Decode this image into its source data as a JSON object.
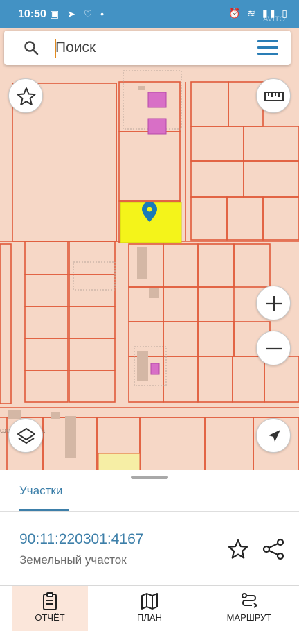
{
  "status_bar": {
    "time": "10:50",
    "watermark": "AVITO"
  },
  "search": {
    "placeholder": "Поиск"
  },
  "map": {
    "street_label": "фская улица",
    "selected_color": "#f4f41a",
    "pin_color": "#1a7ab8",
    "line_color": "#e05a3a"
  },
  "sheet": {
    "tab_label": "Участки",
    "cadastral_number": "90:11:220301:4167",
    "parcel_type": "Земельный участок"
  },
  "nav": {
    "items": [
      {
        "label": "ОТЧЁТ",
        "icon": "report-icon"
      },
      {
        "label": "ПЛАН",
        "icon": "map-plan-icon"
      },
      {
        "label": "МАРШРУТ",
        "icon": "route-icon"
      }
    ]
  }
}
